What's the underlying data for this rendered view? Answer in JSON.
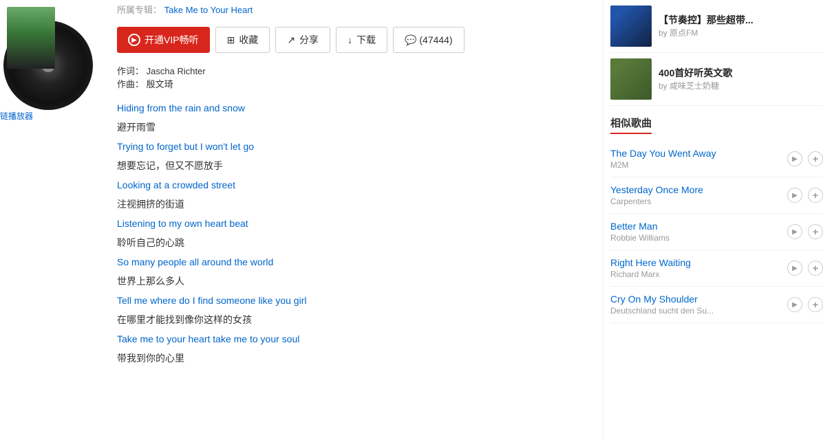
{
  "header": {
    "album_label": "所属专辑：",
    "album_name": "Take Me to Your Heart"
  },
  "buttons": {
    "vip": "开通VIP畅听",
    "collect": "收藏",
    "share": "分享",
    "download": "下载",
    "comment": "(47444)",
    "chain_link": "链播放器"
  },
  "lyrics_meta": {
    "lyricist_label": "作词：",
    "lyricist": "Jascha Richter",
    "composer_label": "作曲：",
    "composer": "殷文琦"
  },
  "lyrics": [
    {
      "en": "Hiding from the rain and snow",
      "zh": "避开雨雪"
    },
    {
      "en": "Trying to forget but I won't let go",
      "zh": "想要忘记，但又不愿放手"
    },
    {
      "en": "Looking at a crowded street",
      "zh": "注视拥挤的街道"
    },
    {
      "en": "Listening to my own heart beat",
      "zh": "聆听自己的心跳"
    },
    {
      "en": "So many people all around the world",
      "zh": "世界上那么多人"
    },
    {
      "en": "Tell me where do I find someone like you girl",
      "zh": "在哪里才能找到像你这样的女孩"
    },
    {
      "en": "Take me to your heart take me to your soul",
      "zh": "带我到你的心里"
    }
  ],
  "playlist": [
    {
      "title": "【节奏控】那些超带...",
      "author": "by 原点FM",
      "thumb_class": "thumb-2"
    },
    {
      "title": "400首好听英文歌",
      "author": "by 咸味芝士奶糖",
      "thumb_class": "thumb-3"
    }
  ],
  "similar_section_title": "相似歌曲",
  "similar_songs": [
    {
      "title": "The Day You Went Away",
      "artist": "M2M"
    },
    {
      "title": "Yesterday Once More",
      "artist": "Carpenters"
    },
    {
      "title": "Better Man",
      "artist": "Robbie Williams"
    },
    {
      "title": "Right Here Waiting",
      "artist": "Richard Marx"
    },
    {
      "title": "Cry On My Shoulder",
      "artist": "Deutschland sucht den Su..."
    }
  ],
  "icons": {
    "play": "▶",
    "add": "+",
    "vip_circle": "▶"
  }
}
